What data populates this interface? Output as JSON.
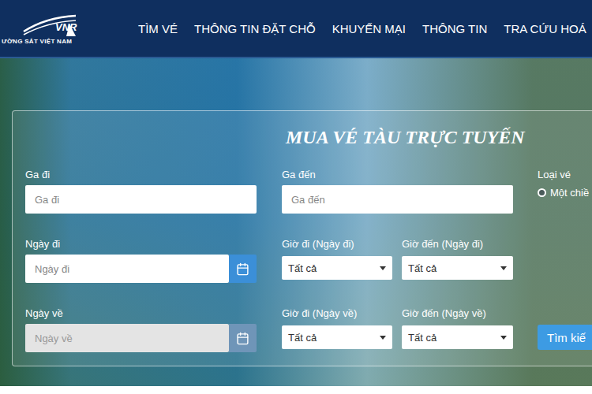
{
  "header": {
    "logo": {
      "abbr": "VNR",
      "name": "ƯỜNG SẮT VIỆT NAM"
    },
    "nav": [
      "TÌM VÉ",
      "THÔNG TIN ĐẶT CHỖ",
      "KHUYẾN MẠI",
      "THÔNG TIN",
      "TRA CỨU HOÁ"
    ]
  },
  "form": {
    "title": "MUA VÉ TÀU TRỰC TUYẾN",
    "rows": [
      [
        {
          "kind": "text",
          "label": "Ga đi",
          "placeholder": "Ga đi",
          "disabled": false
        },
        {
          "kind": "text",
          "label": "Ga đến",
          "placeholder": "Ga đến",
          "disabled": false
        },
        {
          "kind": "radio",
          "label": "Loại vé",
          "options": [
            {
              "label": "Một chiề",
              "selected": true
            }
          ]
        }
      ],
      [
        {
          "kind": "date",
          "label": "Ngày đi",
          "placeholder": "Ngày đi",
          "disabled": false
        },
        {
          "kind": "select",
          "label": "Giờ đi (Ngày đi)",
          "value": "Tất cả"
        },
        {
          "kind": "select",
          "label": "Giờ đến (Ngày đi)",
          "value": "Tất cả"
        }
      ],
      [
        {
          "kind": "date",
          "label": "Ngày về",
          "placeholder": "Ngày về",
          "disabled": true
        },
        {
          "kind": "select",
          "label": "Giờ đi (Ngày về)",
          "value": "Tất cả"
        },
        {
          "kind": "select",
          "label": "Giờ đến (Ngày về)",
          "value": "Tất cả"
        },
        {
          "kind": "button",
          "text": "Tìm kiế"
        }
      ]
    ]
  }
}
